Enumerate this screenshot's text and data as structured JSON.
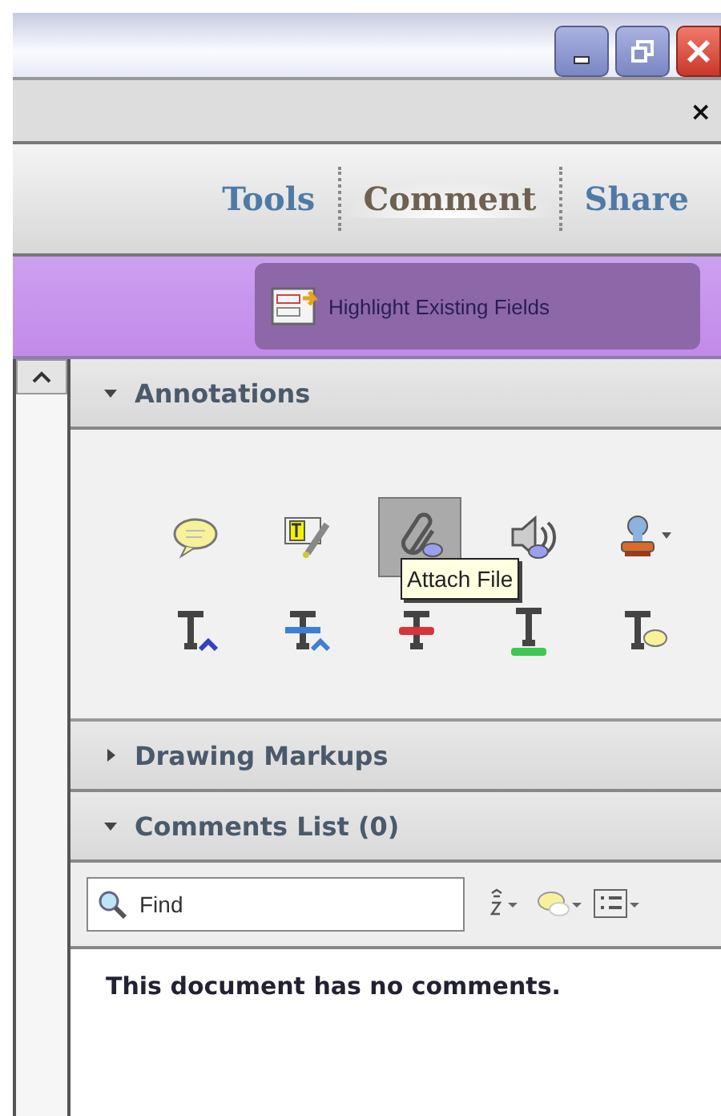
{
  "panel_close": "×",
  "tabs": [
    {
      "label": "Tools",
      "selected": false
    },
    {
      "label": "Comment",
      "selected": true
    },
    {
      "label": "Share",
      "selected": false
    }
  ],
  "toolbar": {
    "button": "Highlight Existing Fields"
  },
  "sections": [
    {
      "title": "Annotations",
      "expanded": true
    },
    {
      "title": "Drawing Markups",
      "expanded": false
    },
    {
      "title": "Comments List (0)",
      "expanded": true
    }
  ],
  "annotation_tools": [
    {
      "kind": "sticky-note",
      "selected": false
    },
    {
      "kind": "text-edit",
      "selected": false
    },
    {
      "kind": "attach-file",
      "selected": true
    },
    {
      "kind": "sound",
      "selected": false
    },
    {
      "kind": "stamp",
      "selected": false
    },
    {
      "kind": "insert-text",
      "selected": false
    },
    {
      "kind": "replace-text",
      "selected": false
    },
    {
      "kind": "strikethrough",
      "selected": false
    },
    {
      "kind": "underline",
      "selected": false
    },
    {
      "kind": "text-comment",
      "selected": false
    }
  ],
  "tooltip": "Attach File",
  "comments": {
    "search": {
      "placeholder": "Find"
    },
    "message": "This document has no comments."
  }
}
